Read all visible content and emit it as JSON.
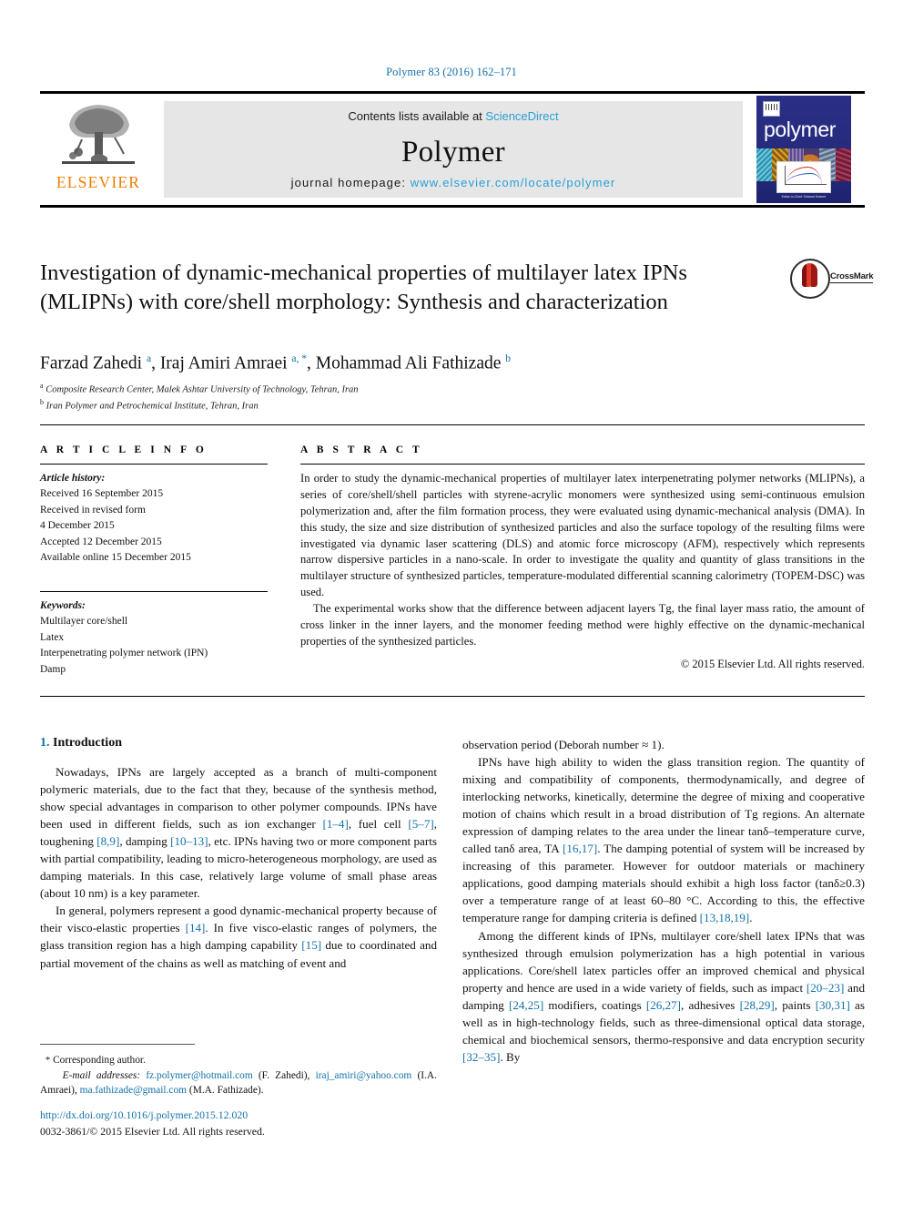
{
  "running_head": "Polymer 83 (2016) 162–171",
  "masthead": {
    "publisher_name": "ELSEVIER",
    "contents_prefix": "Contents lists available at ",
    "contents_link": "ScienceDirect",
    "journal_title": "Polymer",
    "homepage_prefix": "journal homepage: ",
    "homepage_url": "www.elsevier.com/locate/polymer",
    "cover_word": "polymer",
    "cover_caption": "Editor-in-Chief: Edward Kramer"
  },
  "article": {
    "title": "Investigation of dynamic-mechanical properties of multilayer latex IPNs (MLIPNs) with core/shell morphology: Synthesis and characterization",
    "crossmark_label": "CrossMark",
    "authors_html": "Farzad Zahedi <sup>a</sup>, Iraj Amiri Amraei <sup>a, *</sup>, Mohammad Ali Fathizade <sup>b</sup>",
    "affiliation_a": "Composite Research Center, Malek Ashtar University of Technology, Tehran, Iran",
    "affiliation_b": "Iran Polymer and Petrochemical Institute, Tehran, Iran"
  },
  "article_info": {
    "label": "A R T I C L E   I N F O",
    "history_label": "Article history:",
    "history": [
      "Received 16 September 2015",
      "Received in revised form",
      "4 December 2015",
      "Accepted 12 December 2015",
      "Available online 15 December 2015"
    ],
    "keywords_label": "Keywords:",
    "keywords": [
      "Multilayer core/shell",
      "Latex",
      "Interpenetrating polymer network (IPN)",
      "Damp"
    ]
  },
  "abstract": {
    "label": "A B S T R A C T",
    "paragraph_1": "In order to study the dynamic-mechanical properties of multilayer latex interpenetrating polymer networks (MLIPNs), a series of core/shell/shell particles with styrene-acrylic monomers were synthesized using semi-continuous emulsion polymerization and, after the film formation process, they were evaluated using dynamic-mechanical analysis (DMA). In this study, the size and size distribution of synthesized particles and also the surface topology of the resulting films were investigated via dynamic laser scattering (DLS) and atomic force microscopy (AFM), respectively which represents narrow dispersive particles in a nano-scale. In order to investigate the quality and quantity of glass transitions in the multilayer structure of synthesized particles, temperature-modulated differential scanning calorimetry (TOPEM-DSC) was used.",
    "paragraph_2": "The experimental works show that the difference between adjacent layers Tg, the final layer mass ratio, the amount of cross linker in the inner layers, and the monomer feeding method were highly effective on the dynamic-mechanical properties of the synthesized particles.",
    "copyright": "© 2015 Elsevier Ltd. All rights reserved."
  },
  "body": {
    "section_number": "1.",
    "section_title": "Introduction",
    "left_paragraphs": [
      "Nowadays, IPNs are largely accepted as a branch of multi-component polymeric materials, due to the fact that they, because of the synthesis method, show special advantages in comparison to other polymer compounds. IPNs have been used in different fields, such as ion exchanger [1–4], fuel cell [5–7], toughening [8,9], damping [10–13], etc. IPNs having two or more component parts with partial compatibility, leading to micro-heterogeneous morphology, are used as damping materials. In this case, relatively large volume of small phase areas (about 10 nm) is a key parameter.",
      "In general, polymers represent a good dynamic-mechanical property because of their visco-elastic properties [14]. In five visco-elastic ranges of polymers, the glass transition region has a high damping capability [15] due to coordinated and partial movement of the chains as well as matching of event and"
    ],
    "right_paragraphs": [
      "observation period (Deborah number ≈ 1).",
      "IPNs have high ability to widen the glass transition region. The quantity of mixing and compatibility of components, thermodynamically, and degree of interlocking networks, kinetically, determine the degree of mixing and cooperative motion of chains which result in a broad distribution of Tg regions. An alternate expression of damping relates to the area under the linear tanδ–temperature curve, called tanδ area, TA [16,17]. The damping potential of system will be increased by increasing of this parameter. However for outdoor materials or machinery applications, good damping materials should exhibit a high loss factor (tanδ≥0.3) over a temperature range of at least 60–80 °C. According to this, the effective temperature range for damping criteria is defined [13,18,19].",
      "Among the different kinds of IPNs, multilayer core/shell latex IPNs that was synthesized through emulsion polymerization has a high potential in various applications. Core/shell latex particles offer an improved chemical and physical property and hence are used in a wide variety of fields, such as impact [20–23] and damping [24,25] modifiers, coatings [26,27], adhesives [28,29], paints [30,31] as well as in high-technology fields, such as three-dimensional optical data storage, chemical and biochemical sensors, thermo-responsive and data encryption security [32–35]. By"
    ]
  },
  "footnotes": {
    "corresponding_marker": "*",
    "corresponding_text": "Corresponding author.",
    "email_label": "E-mail addresses:",
    "emails": [
      {
        "address": "fz.polymer@hotmail.com",
        "owner": "(F. Zahedi),"
      },
      {
        "address": "iraj_amiri@yahoo.com",
        "owner": "(I.A. Amraei),"
      },
      {
        "address": "ma.fathizade@gmail.com",
        "owner": "(M.A. Fathizade)."
      }
    ],
    "doi": "http://dx.doi.org/10.1016/j.polymer.2015.12.020",
    "issn_line": "0032-3861/© 2015 Elsevier Ltd. All rights reserved."
  },
  "colors": {
    "link_blue": "#1271a8",
    "sciencedirect_blue": "#2a9fd6",
    "elsevier_orange": "#f07d00",
    "cover_navy": "#2a2f86"
  }
}
